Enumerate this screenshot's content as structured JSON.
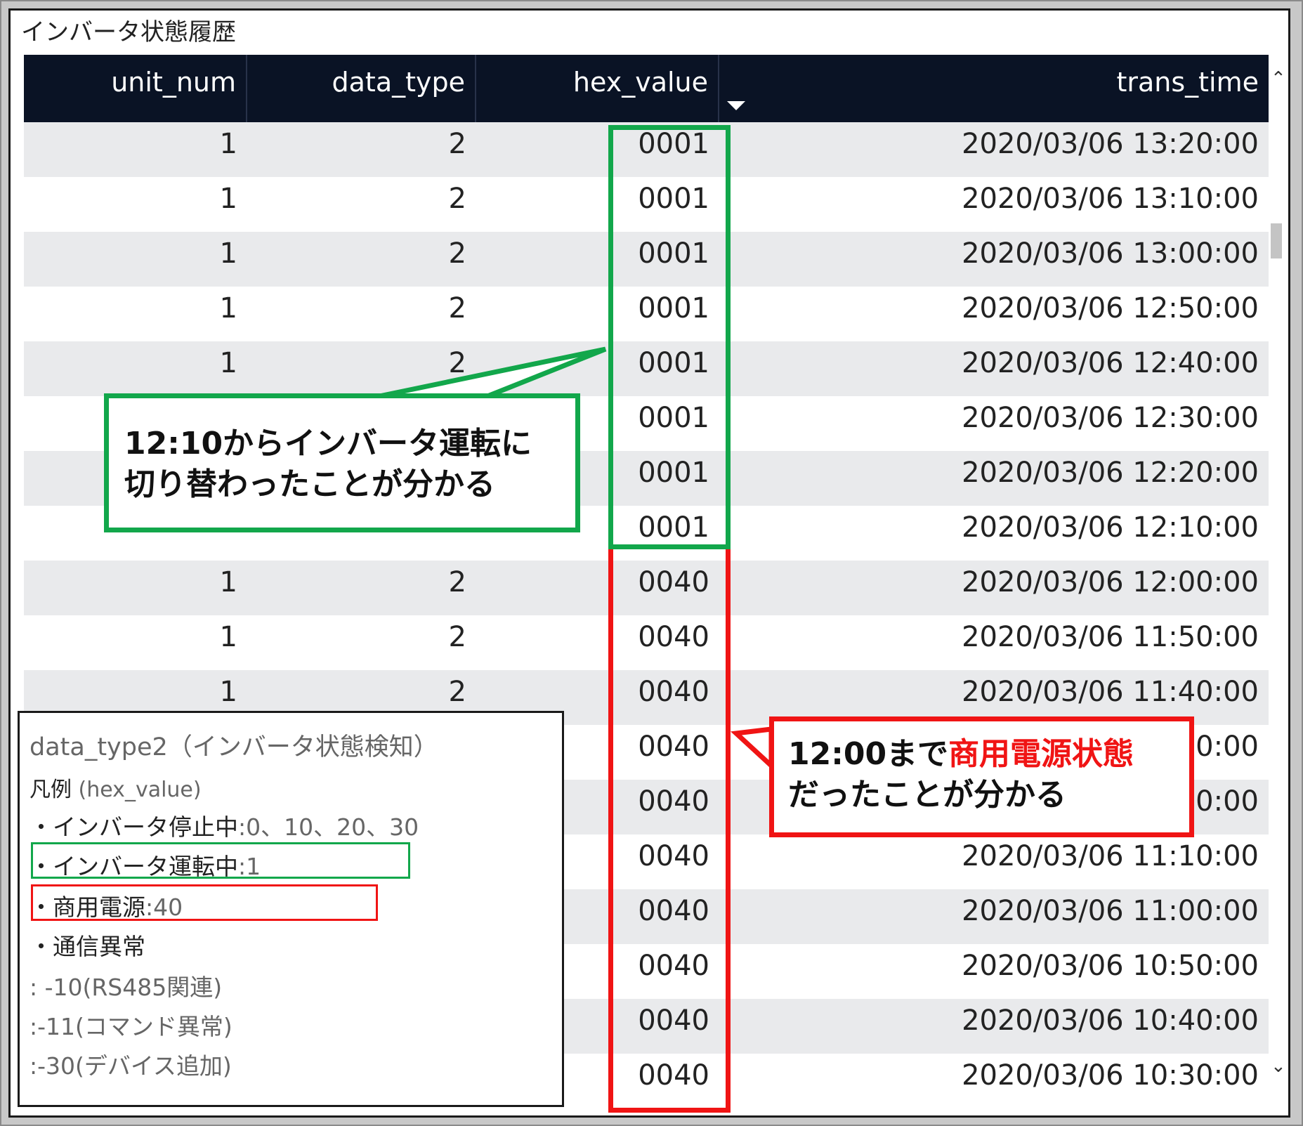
{
  "window": {
    "title": "インバータ状態履歴"
  },
  "table": {
    "columns": [
      "unit_num",
      "data_type",
      "hex_value",
      "trans_time"
    ],
    "rows": [
      [
        "1",
        "2",
        "0001",
        "2020/03/06 13:20:00"
      ],
      [
        "1",
        "2",
        "0001",
        "2020/03/06 13:10:00"
      ],
      [
        "1",
        "2",
        "0001",
        "2020/03/06 13:00:00"
      ],
      [
        "1",
        "2",
        "0001",
        "2020/03/06 12:50:00"
      ],
      [
        "1",
        "2",
        "0001",
        "2020/03/06 12:40:00"
      ],
      [
        "",
        "",
        "0001",
        "2020/03/06 12:30:00"
      ],
      [
        "",
        "",
        "0001",
        "2020/03/06 12:20:00"
      ],
      [
        "",
        "",
        "0001",
        "2020/03/06 12:10:00"
      ],
      [
        "1",
        "2",
        "0040",
        "2020/03/06 12:00:00"
      ],
      [
        "1",
        "2",
        "0040",
        "2020/03/06 11:50:00"
      ],
      [
        "1",
        "2",
        "0040",
        "2020/03/06 11:40:00"
      ],
      [
        "",
        "",
        "0040",
        "0:00"
      ],
      [
        "",
        "",
        "0040",
        "0:00"
      ],
      [
        "",
        "",
        "0040",
        "2020/03/06 11:10:00"
      ],
      [
        "",
        "",
        "0040",
        "2020/03/06 11:00:00"
      ],
      [
        "",
        "",
        "0040",
        "2020/03/06 10:50:00"
      ],
      [
        "",
        "",
        "0040",
        "2020/03/06 10:40:00"
      ],
      [
        "",
        "",
        "0040",
        "2020/03/06 10:30:00"
      ]
    ],
    "scrollbar": {
      "up_icon": "chevron-up-icon",
      "down_icon": "chevron-down-icon"
    },
    "sort_icon": "sort-desc-icon"
  },
  "annotations": {
    "green_callout": {
      "line1": "12:10からインバータ運転に",
      "line2": "切り替わったことが分かる"
    },
    "red_callout": {
      "line1_pre": "12:00まで",
      "line1_highlight": "商用電源状態",
      "line2": "だったことが分かる"
    }
  },
  "legend": {
    "title": "data_type2（インバータ状態検知）",
    "subtitle": "凡例",
    "subtitle_note": " (hex_value)",
    "items": [
      {
        "label": "・インバータ停止中",
        "value": ":0、10、20、30"
      },
      {
        "label": "・インバータ運転中",
        "value": ":1"
      },
      {
        "label": "・商用電源",
        "value": ":40"
      },
      {
        "label": "・通信異常",
        "value": ""
      }
    ],
    "sub_items": [
      ": -10(RS485関連)",
      ":-11(コマンド異常)",
      ":-30(デバイス追加)"
    ]
  },
  "colors": {
    "header_bg": "#0a1325",
    "green": "#12a74b",
    "red": "#f01414",
    "row_alt": "#e9eaec"
  }
}
